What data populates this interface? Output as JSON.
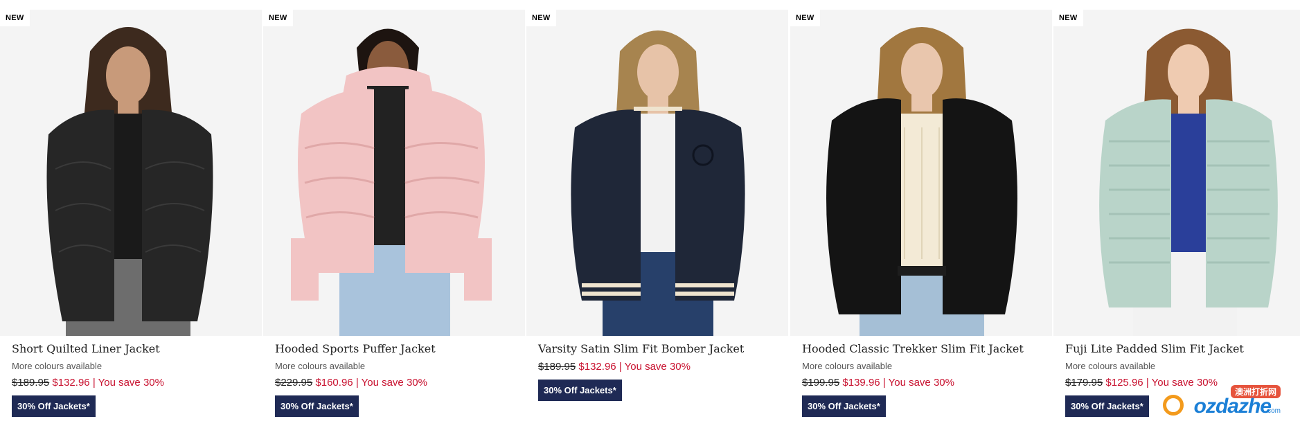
{
  "products": [
    {
      "badge": "NEW",
      "name": "Short Quilted Liner Jacket",
      "more_colours": "More colours available",
      "price_old": "$189.95",
      "price_new": "$132.96",
      "price_save": "| You save 30%",
      "promo": "30% Off Jackets*",
      "jacket_color": "#262626",
      "top_color": "#1a1a1a",
      "bottom_color": "#6d6d6d",
      "hair_color": "#3d2a1e"
    },
    {
      "badge": "NEW",
      "name": "Hooded Sports Puffer Jacket",
      "more_colours": "More colours available",
      "price_old": "$229.95",
      "price_new": "$160.96",
      "price_save": "| You save 30%",
      "promo": "30% Off Jackets*",
      "jacket_color": "#f2c4c4",
      "top_color": "#222222",
      "bottom_color": "#a9c3dc",
      "hair_color": "#1d1410"
    },
    {
      "badge": "NEW",
      "name": "Varsity Satin Slim Fit Bomber Jacket",
      "more_colours": "",
      "price_old": "$189.95",
      "price_new": "$132.96",
      "price_save": "| You save 30%",
      "promo": "30% Off Jackets*",
      "jacket_color": "#1f2738",
      "top_color": "#f2f2f2",
      "bottom_color": "#27406a",
      "hair_color": "#a7844f"
    },
    {
      "badge": "NEW",
      "name": "Hooded Classic Trekker Slim Fit Jacket",
      "more_colours": "More colours available",
      "price_old": "$199.95",
      "price_new": "$139.96",
      "price_save": "| You save 30%",
      "promo": "30% Off Jackets*",
      "jacket_color": "#141414",
      "top_color": "#f3ead6",
      "bottom_color": "#a5bfd6",
      "hair_color": "#a1773f"
    },
    {
      "badge": "NEW",
      "name": "Fuji Lite Padded Slim Fit Jacket",
      "more_colours": "More colours available",
      "price_old": "$179.95",
      "price_new": "$125.96",
      "price_save": "| You save 30%",
      "promo": "30% Off Jackets*",
      "jacket_color": "#b9d4c9",
      "top_color": "#2a3f9a",
      "bottom_color": "#f2f2f2",
      "hair_color": "#8b5a32"
    }
  ],
  "watermark": {
    "top": "澳洲打折网",
    "main": "ozdazhe",
    "com": ".com"
  },
  "colors": {
    "image_bg": "#f4f4f4",
    "sale_red": "#c8102e",
    "promo_navy": "#1f2a55"
  }
}
